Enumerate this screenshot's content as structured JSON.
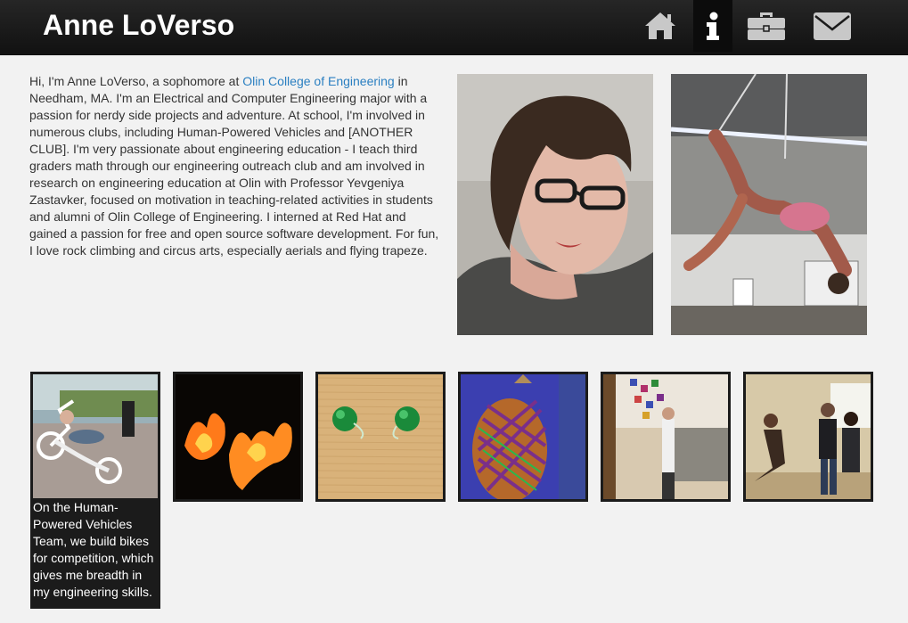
{
  "header": {
    "brand": "Anne LoVerso",
    "nav": [
      {
        "icon": "home-icon",
        "active": false
      },
      {
        "icon": "info-icon",
        "active": true
      },
      {
        "icon": "briefcase-icon",
        "active": false
      },
      {
        "icon": "envelope-icon",
        "active": false
      }
    ]
  },
  "bio": {
    "intro": "Hi, I'm Anne LoVerso, a sophomore at ",
    "college_link": "Olin College of Engineering",
    "body": " in Needham, MA. I'm an Electrical and Computer Engineering major with a passion for nerdy side projects and adventure. At school, I'm involved in numerous clubs, including Human-Powered Vehicles and [ANOTHER CLUB]. I'm very passionate about engineering education - I teach third graders math through our engineering outreach club and am involved in research on engineering education at Olin with Professor Yevgeniya Zastavker, focused on motivation in teaching-related activities in students and alumni of Olin College of Engineering. I interned at Red Hat and gained a passion for free and open source software development. For fun, I love rock climbing and circus arts, especially aerials and flying trapeze."
  },
  "gallery": {
    "caption": "On the Human-Powered Vehicles Team, we build bikes for competition, which gives me breadth in my engineering skills."
  },
  "colors": {
    "navbar": "#1b1b1b",
    "link": "#2a7fc1",
    "background": "#f2f2f2",
    "icon": "#c8c8c8"
  }
}
